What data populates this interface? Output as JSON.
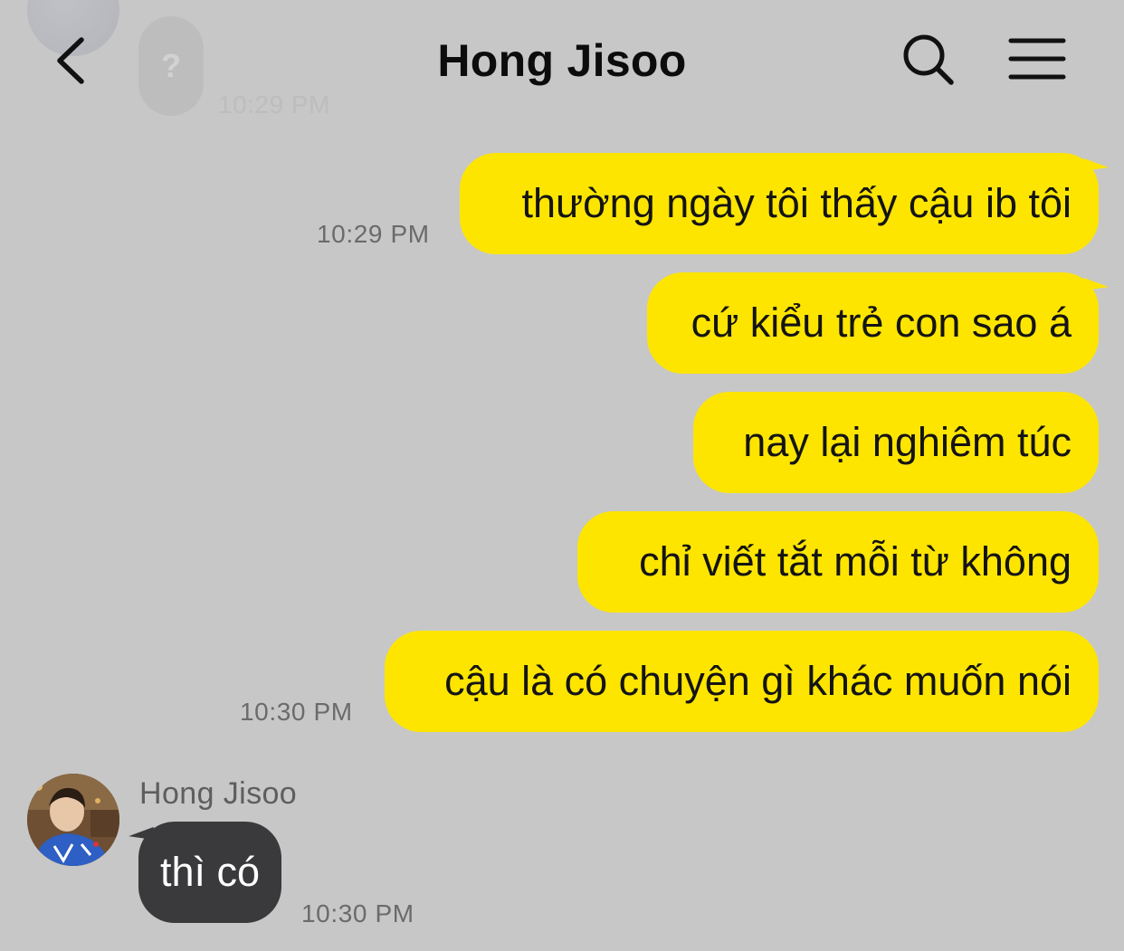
{
  "header": {
    "title": "Hong Jisoo",
    "back_icon": "chevron-left-icon",
    "search_icon": "search-icon",
    "menu_icon": "menu-icon"
  },
  "previous_message": {
    "bubble_text": "?",
    "time": "10:29 PM"
  },
  "outgoing_messages": [
    {
      "text": "thường ngày tôi thấy cậu ib tôi",
      "time": "10:29 PM"
    },
    {
      "text": "cứ kiểu trẻ con sao á",
      "time": ""
    },
    {
      "text": "nay lại nghiêm túc",
      "time": ""
    },
    {
      "text": "chỉ viết tắt mỗi từ không",
      "time": ""
    },
    {
      "text": "cậu là có chuyện gì khác muốn nói",
      "time": "10:30 PM"
    }
  ],
  "incoming_message": {
    "sender": "Hong Jisoo",
    "text": "thì có",
    "time": "10:30 PM"
  },
  "colors": {
    "background": "#c7c7c7",
    "outgoing_bubble": "#fee500",
    "incoming_bubble": "#3a3a3c",
    "timestamp": "#6b6b6b"
  }
}
